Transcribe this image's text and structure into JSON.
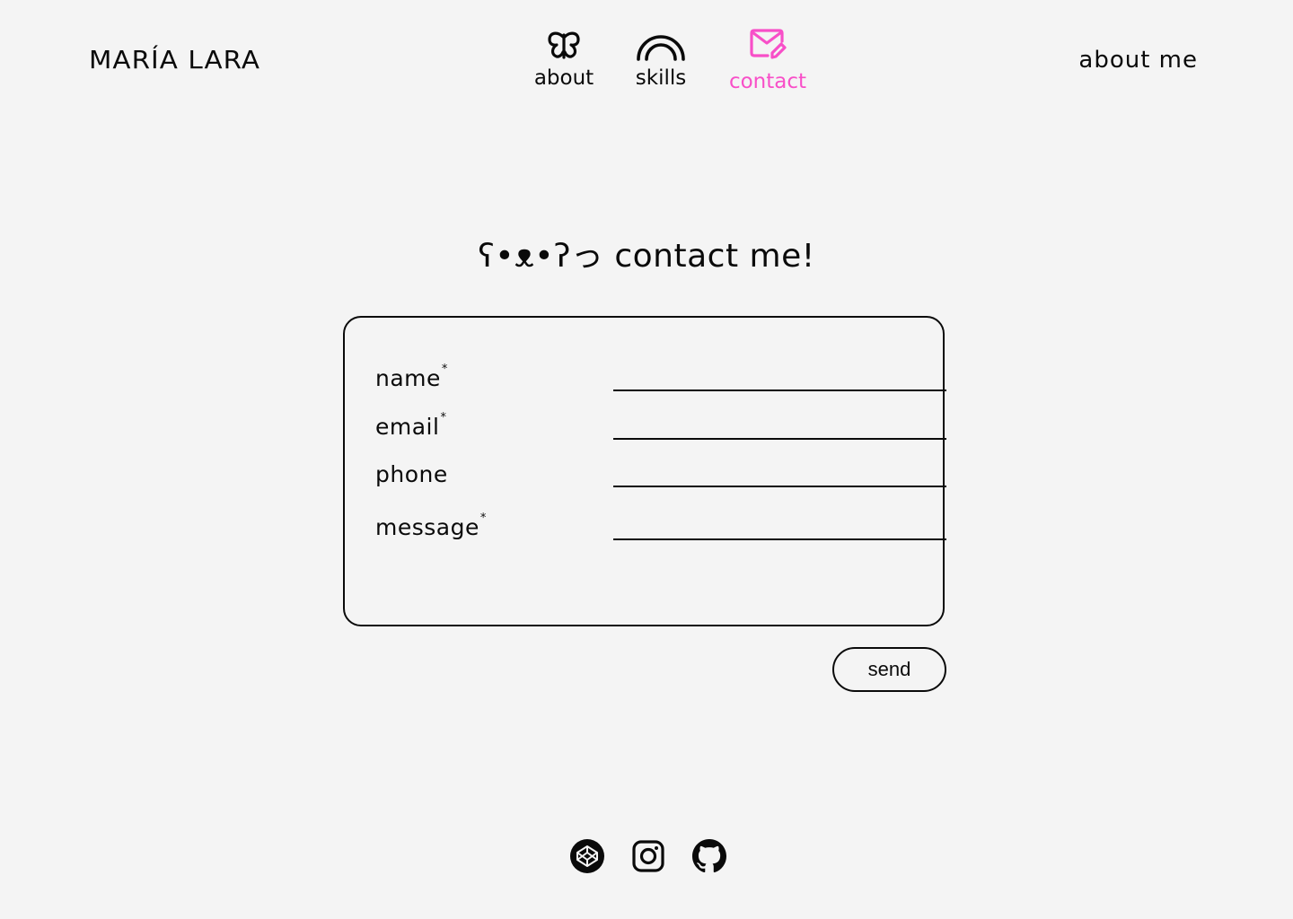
{
  "header": {
    "brand": "MARÍA LARA",
    "top_link": "about me"
  },
  "nav": {
    "items": [
      {
        "label": "about",
        "icon": "butterfly-icon",
        "active": false
      },
      {
        "label": "skills",
        "icon": "rainbow-icon",
        "active": false
      },
      {
        "label": "contact",
        "icon": "mail-edit-icon",
        "active": true
      }
    ],
    "active_color": "#f84fc8"
  },
  "main": {
    "heading": "ʕ•ᴥ•ʔっ contact me!",
    "form": {
      "fields": [
        {
          "label": "name",
          "required": "*",
          "value": ""
        },
        {
          "label": "email",
          "required": "*",
          "value": ""
        },
        {
          "label": "phone",
          "required": "",
          "value": ""
        },
        {
          "label": "message",
          "required": "*",
          "value": ""
        }
      ],
      "submit_label": "send"
    }
  },
  "footer": {
    "socials": [
      {
        "icon": "codepen-icon"
      },
      {
        "icon": "instagram-icon"
      },
      {
        "icon": "github-icon"
      }
    ]
  },
  "colors": {
    "background": "#f4f4f4",
    "text": "#0a0a0a",
    "accent": "#f84fc8"
  }
}
